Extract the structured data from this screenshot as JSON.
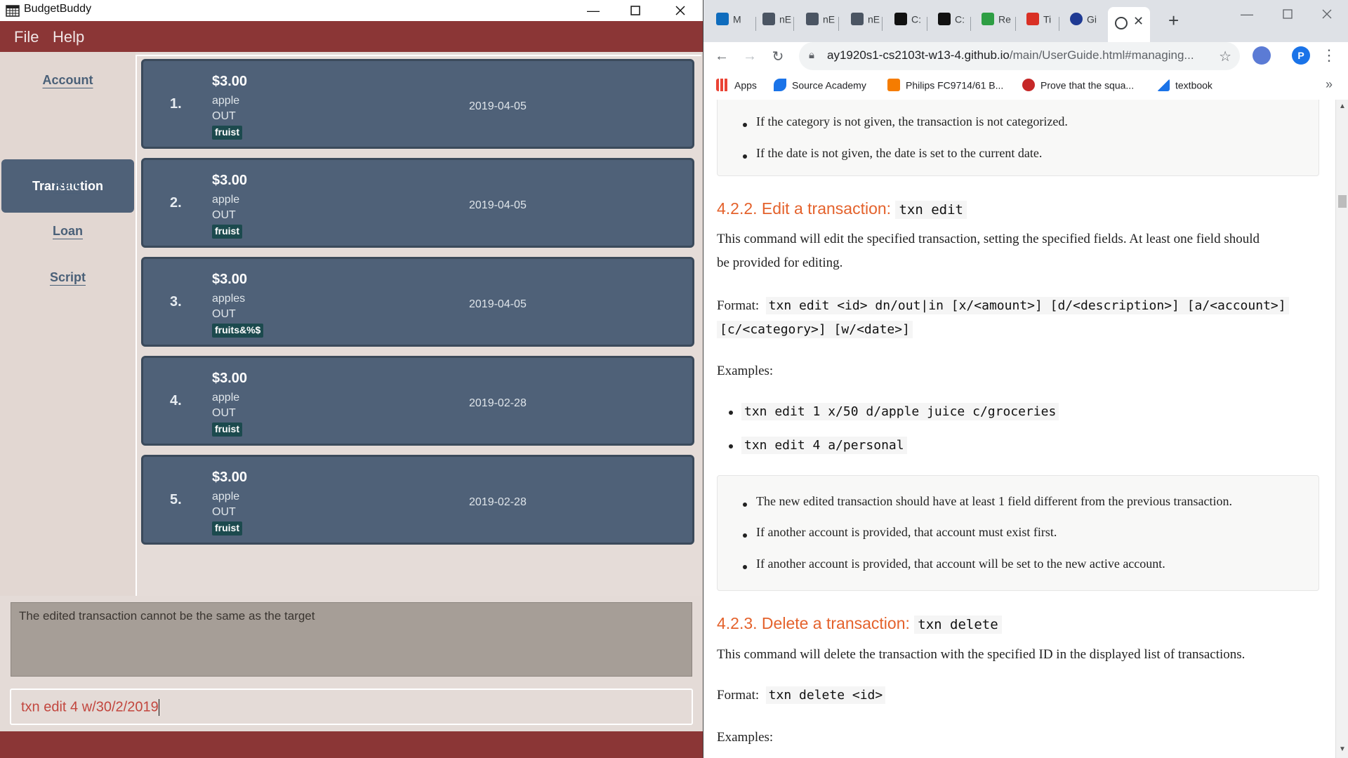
{
  "app": {
    "title": "BudgetBuddy",
    "menu": [
      "File",
      "Help"
    ],
    "nav": {
      "account": "Account",
      "transaction": "Transaction",
      "rule": "Rule",
      "loan": "Loan",
      "script": "Script"
    },
    "transactions": [
      {
        "index": "1.",
        "amount": "$3.00",
        "description": "apple",
        "direction": "OUT",
        "category": "fruist",
        "date": "2019-04-05"
      },
      {
        "index": "2.",
        "amount": "$3.00",
        "description": "apple",
        "direction": "OUT",
        "category": "fruist",
        "date": "2019-04-05"
      },
      {
        "index": "3.",
        "amount": "$3.00",
        "description": "apples",
        "direction": "OUT",
        "category": "fruits&%$",
        "date": "2019-04-05"
      },
      {
        "index": "4.",
        "amount": "$3.00",
        "description": "apple",
        "direction": "OUT",
        "category": "fruist",
        "date": "2019-02-28"
      },
      {
        "index": "5.",
        "amount": "$3.00",
        "description": "apple",
        "direction": "OUT",
        "category": "fruist",
        "date": "2019-02-28"
      }
    ],
    "result_message": "The edited transaction cannot be the same as the target",
    "command_input": "txn edit 4 w/30/2/2019",
    "colors": {
      "menubar": "#8b3636",
      "card": "#4f6178",
      "tag": "#1c4a4e",
      "command_text": "#c2463e"
    }
  },
  "browser": {
    "tabs": [
      {
        "title": "M",
        "icon": "outlook-icon"
      },
      {
        "title": "nE",
        "icon": "nus-icon"
      },
      {
        "title": "nE",
        "icon": "nus-icon"
      },
      {
        "title": "nE",
        "icon": "nus-icon"
      },
      {
        "title": "C:",
        "icon": "graduation-cap-icon"
      },
      {
        "title": "C:",
        "icon": "graduation-cap-icon"
      },
      {
        "title": "Re",
        "icon": "grid-icon"
      },
      {
        "title": "Ti",
        "icon": "gmail-icon"
      },
      {
        "title": "Gi",
        "icon": "github-icon"
      }
    ],
    "url_host": "ay1920s1-cs2103t-w13-4.github.io",
    "url_path": "/main/UserGuide.html#managing...",
    "profile_initial": "P",
    "bookmarks": [
      "Apps",
      "Source Academy",
      "Philips FC9714/61 B...",
      "Prove that the squa...",
      "textbook"
    ]
  },
  "doc": {
    "notes_top": [
      "If the category is not given, the transaction is not categorized.",
      "If the date is not given, the date is set to the current date."
    ],
    "edit_heading": "4.2.2. Edit a transaction:",
    "edit_cmd": "txn edit",
    "edit_desc_1": "This command will edit the specified transaction, setting the specified fields. At least one field should",
    "edit_desc_2": "be provided for editing.",
    "format_label": "Format:",
    "edit_format_1": "txn edit <id> dn/out|in [x/<amount>] [d/<description>] [a/<account>]",
    "edit_format_2": "[c/<category>] [w/<date>]",
    "examples_label": "Examples:",
    "edit_examples": [
      "txn edit 1 x/50 d/apple juice c/groceries",
      "txn edit 4 a/personal"
    ],
    "edit_notes": [
      "The new edited transaction should have at least 1 field different from the previous transaction.",
      "If another account is provided, that account must exist first.",
      "If another account is provided, that account will be set to the new active account."
    ],
    "delete_heading": "4.2.3. Delete a transaction:",
    "delete_cmd": "txn delete",
    "delete_desc": "This command will delete the transaction with the specified ID in the displayed list of transactions.",
    "delete_format": "txn delete <id>",
    "heading_color": "#e4622c"
  }
}
